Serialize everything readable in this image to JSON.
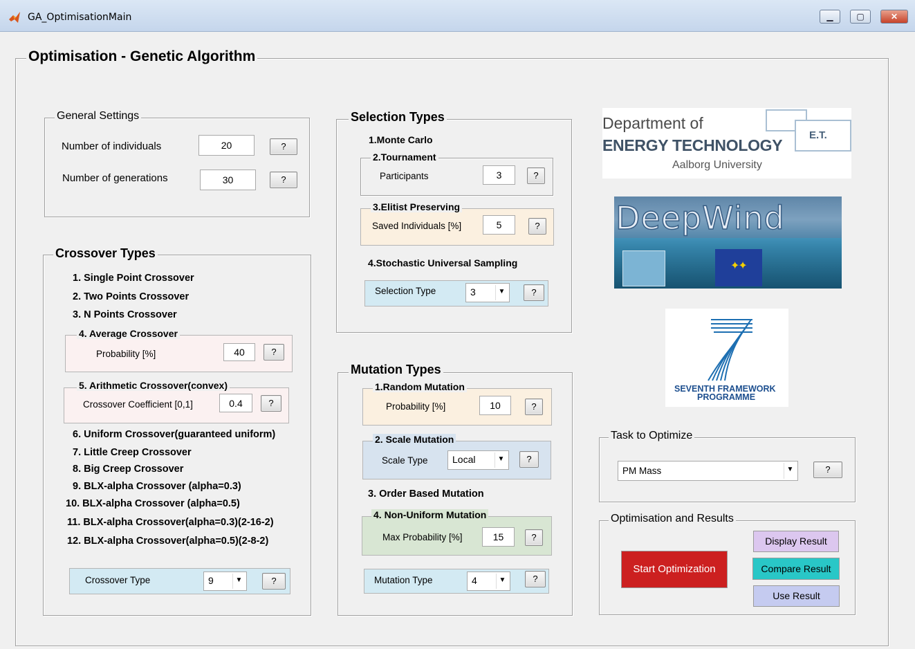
{
  "window": {
    "title": "GA_OptimisationMain",
    "min_label": "▁",
    "max_label": "▢",
    "close_label": "✕"
  },
  "main": {
    "title": "Optimisation - Genetic Algorithm"
  },
  "general": {
    "title": "General Settings",
    "individuals_label": "Number of individuals",
    "individuals_value": "20",
    "generations_label": "Number of generations",
    "generations_value": "30",
    "help": "?"
  },
  "crossover": {
    "title": "Crossover Types",
    "items": [
      "1. Single Point Crossover",
      "2. Two Points Crossover",
      "3. N Points Crossover",
      "6. Uniform Crossover(guaranteed uniform)",
      "7. Little Creep Crossover",
      "8. Big Creep Crossover",
      "9. BLX-alpha Crossover (alpha=0.3)",
      "10. BLX-alpha Crossover (alpha=0.5)",
      "11. BLX-alpha Crossover(alpha=0.3)(2-16-2)",
      "12. BLX-alpha Crossover(alpha=0.5)(2-8-2)"
    ],
    "average": {
      "title": "4. Average Crossover",
      "label": "Probability [%]",
      "value": "40"
    },
    "arithmetic": {
      "title": "5. Arithmetic Crossover(convex)",
      "label": "Crossover Coefficient [0,1]",
      "value": "0.4"
    },
    "type_label": "Crossover Type",
    "type_value": "9",
    "help": "?"
  },
  "selection": {
    "title": "Selection Types",
    "monte_carlo": "1.Monte Carlo",
    "tournament": {
      "title": "2.Tournament",
      "label": "Participants",
      "value": "3"
    },
    "elitist": {
      "title": "3.Elitist Preserving",
      "label": "Saved Individuals [%]",
      "value": "5"
    },
    "stochastic": "4.Stochastic Universal Sampling",
    "type_label": "Selection Type",
    "type_value": "3",
    "help": "?"
  },
  "mutation": {
    "title": "Mutation Types",
    "random": {
      "title": "1.Random Mutation",
      "label": "Probability [%]",
      "value": "10"
    },
    "scale": {
      "title": "2. Scale Mutation",
      "label": "Scale Type",
      "value": "Local"
    },
    "order": "3. Order Based Mutation",
    "nonuniform": {
      "title": "4. Non-Uniform Mutation",
      "label": "Max Probability [%]",
      "value": "15"
    },
    "type_label": "Mutation Type",
    "type_value": "4",
    "help": "?"
  },
  "logos": {
    "dept_line1": "Department of",
    "dept_line2": "ENERGY TECHNOLOGY",
    "dept_line3": "Aalborg University",
    "dept_badge": "E.T.",
    "deepwind": "DeepWind",
    "fp7_line1": "SEVENTH FRAMEWORK",
    "fp7_line2": "PROGRAMME"
  },
  "task": {
    "title": "Task to Optimize",
    "value": "PM Mass",
    "help": "?"
  },
  "results": {
    "title": "Optimisation and Results",
    "start": "Start Optimization",
    "display": "Display Result",
    "compare": "Compare Result",
    "use": "Use Result"
  },
  "colors": {
    "pink_panel": "#fbf1f1",
    "beige_panel": "#fbf0e0",
    "blue_panel": "#d3eaf3",
    "steel_panel": "#d7e3ef",
    "green_panel": "#d8e6d3",
    "start_button": "#cc2020",
    "display_button": "#dcc7ef",
    "compare_button": "#29c7c7",
    "use_button": "#c5cbf0"
  }
}
